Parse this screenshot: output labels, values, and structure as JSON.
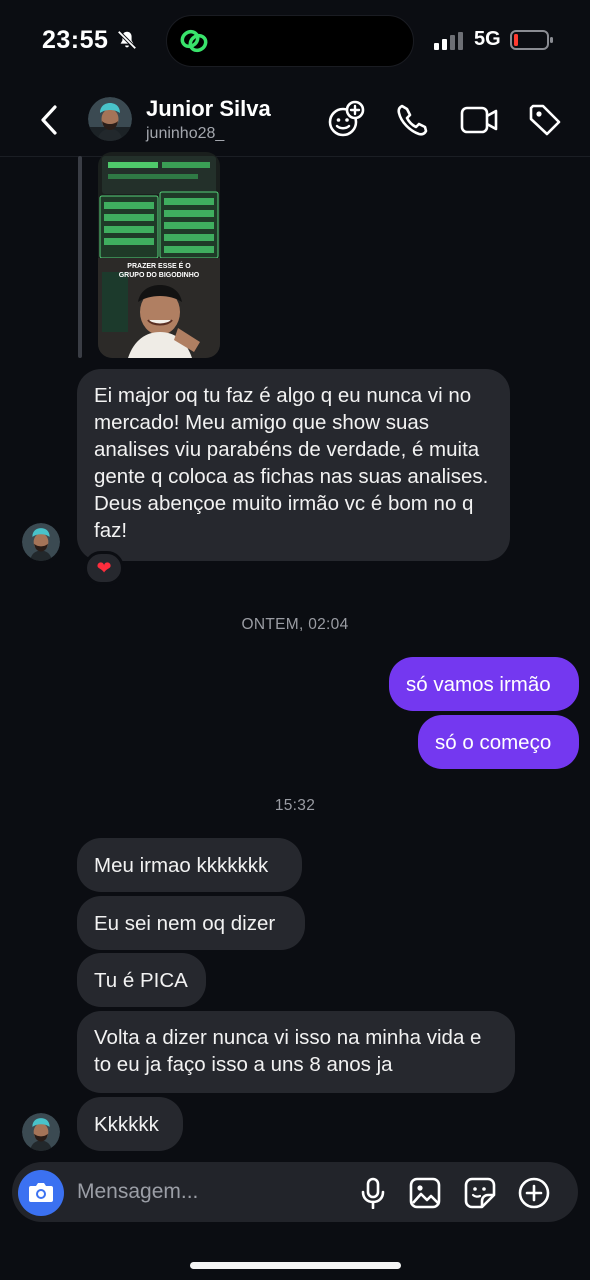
{
  "status_bar": {
    "time": "23:55",
    "network": "5G"
  },
  "header": {
    "name": "Junior Silva",
    "username": "juninho28_"
  },
  "story": {
    "caption": "PRAZER ESSE É O GRUPO DO BIGODINHO",
    "emoji": "👋😂👌"
  },
  "messages": {
    "long": "Ei major oq tu faz é algo q eu nunca vi no mercado! Meu amigo que show suas analises viu parabéns de verdade, é muita gente q coloca as fichas nas suas analises. Deus abençoe muito irmão vc é bom no q faz!",
    "reaction": "❤",
    "timestamp1": "ONTEM, 02:04",
    "out1": "só vamos irmão",
    "out2": "só o começo",
    "timestamp2": "15:32",
    "in1": "Meu irmao kkkkkkk",
    "in2": "Eu sei nem oq dizer",
    "in3": "Tu é PICA",
    "in4": "Volta a dizer nunca vi isso na minha vida e to eu ja faço isso a uns 8 anos ja",
    "in5": "Kkkkkk"
  },
  "composer": {
    "placeholder": "Mensagem..."
  },
  "colors": {
    "background": "#0b0d12",
    "incoming_bubble": "#26282e",
    "outgoing_bubble": "#7438f0",
    "camera_button": "#3b71f1"
  }
}
